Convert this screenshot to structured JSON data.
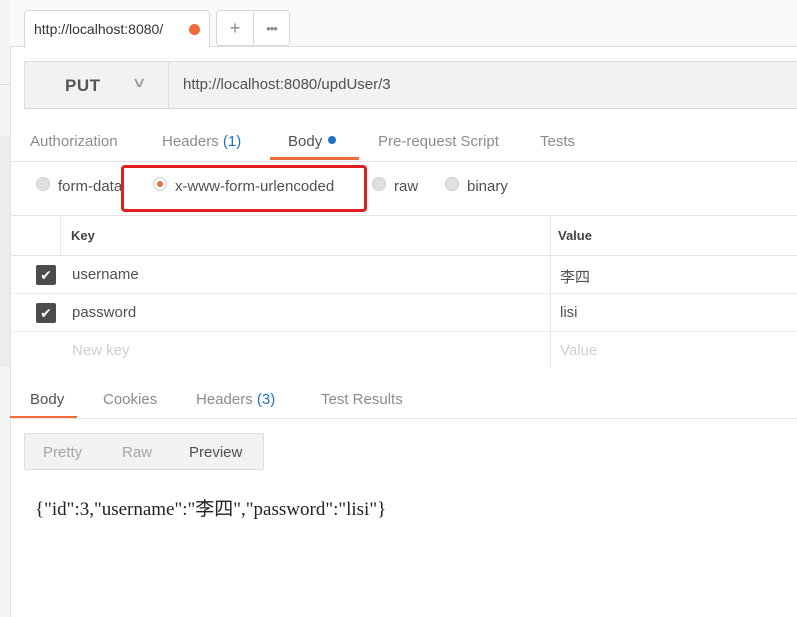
{
  "tab": {
    "title": "http://localhost:8080/",
    "unsaved_dot_color": "#f26b3a"
  },
  "tab_buttons": {
    "add_label": "+",
    "more_label": "•••"
  },
  "request": {
    "method": "PUT",
    "url": "http://localhost:8080/updUser/3"
  },
  "request_tabs": [
    {
      "label": "Authorization"
    },
    {
      "label": "Headers",
      "count": "(1)"
    },
    {
      "label": "Body",
      "active": true
    },
    {
      "label": "Pre-request Script"
    },
    {
      "label": "Tests"
    }
  ],
  "body_types": [
    {
      "label": "form-data",
      "selected": false
    },
    {
      "label": "x-www-form-urlencoded",
      "selected": true
    },
    {
      "label": "raw",
      "selected": false
    },
    {
      "label": "binary",
      "selected": false
    }
  ],
  "params": {
    "headers": {
      "key": "Key",
      "value": "Value"
    },
    "rows": [
      {
        "key": "username",
        "value": "李四",
        "enabled": true
      },
      {
        "key": "password",
        "value": "lisi",
        "enabled": true
      }
    ],
    "new_key_placeholder": "New key",
    "new_value_placeholder": "Value"
  },
  "response_tabs": [
    {
      "label": "Body",
      "active": true
    },
    {
      "label": "Cookies"
    },
    {
      "label": "Headers",
      "count": "(3)"
    },
    {
      "label": "Test Results"
    }
  ],
  "view_modes": [
    {
      "label": "Pretty"
    },
    {
      "label": "Raw"
    },
    {
      "label": "Preview",
      "active": true
    }
  ],
  "response_body": "{\"id\":3,\"username\":\"李四\",\"password\":\"lisi\"}",
  "colors": {
    "accent": "#f26b3a",
    "link_blue": "#1f6fc5",
    "highlight_box": "#e02020"
  }
}
